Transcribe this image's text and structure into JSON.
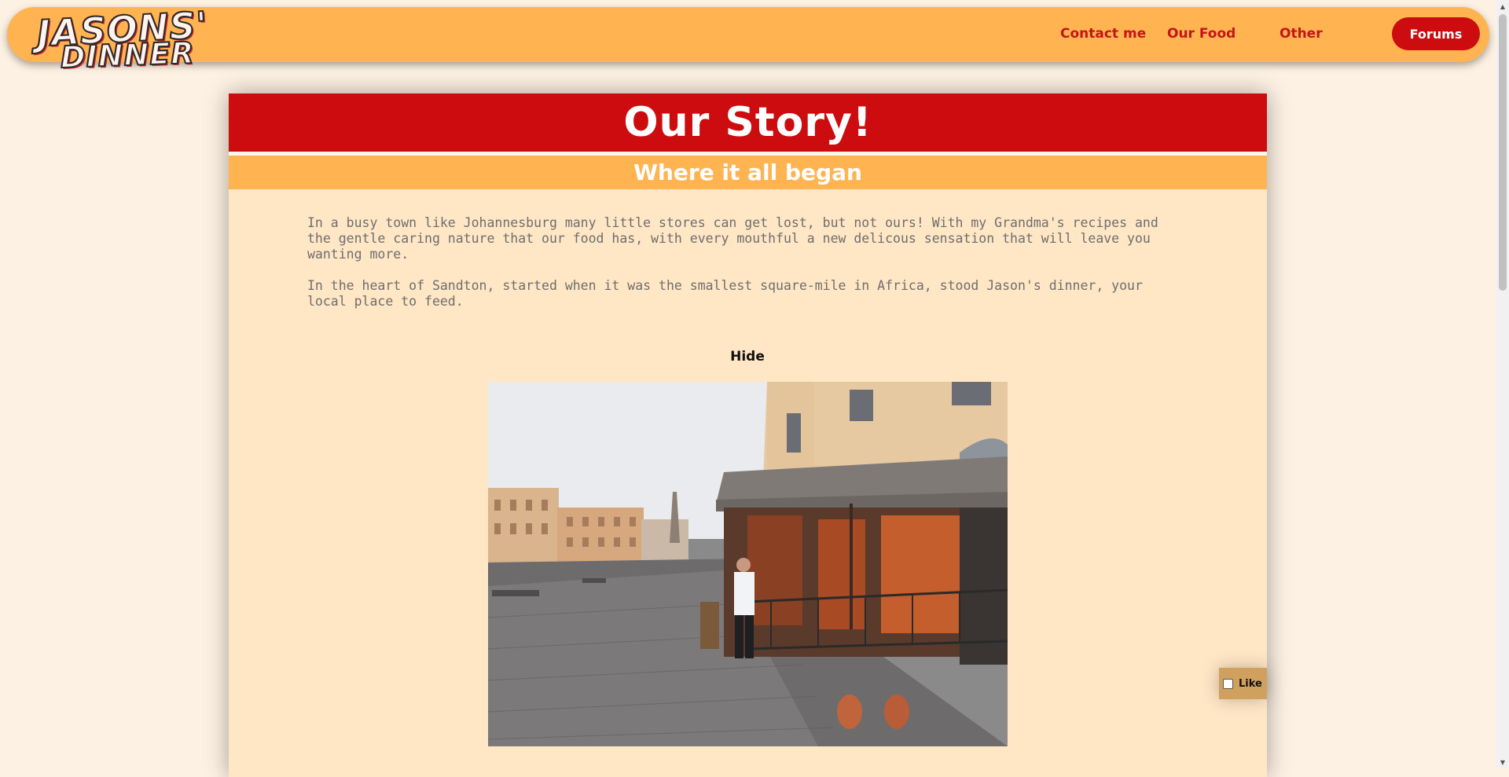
{
  "logo": {
    "line1": "JASONS'",
    "line2": "DINNER"
  },
  "nav": {
    "contact": "Contact me",
    "food": "Our Food",
    "other": "Other",
    "forums": "Forums"
  },
  "story": {
    "title": "Our Story!",
    "subtitle": "Where it all began",
    "paragraph1": "In a busy town like Johannesburg many little stores can get lost, but not ours! With my Grandma's recipes and the gentle caring nature that our food has, with every mouthful a new delicous sensation that will leave you wanting more.",
    "paragraph2": "In the heart of Sandton, started when it was the smallest square-mile in Africa, stood Jason's dinner, your local place to feed.",
    "hide_label": "Hide"
  },
  "like": {
    "label": "Like",
    "checked": false
  },
  "colors": {
    "page_bg": "#fdf1e3",
    "header_orange": "#ffb451",
    "brand_red": "#cc0c0e",
    "card_bg": "#ffe6c5"
  },
  "icons": {
    "scroll_up": "triangle-up-icon",
    "scroll_down": "triangle-down-icon"
  }
}
